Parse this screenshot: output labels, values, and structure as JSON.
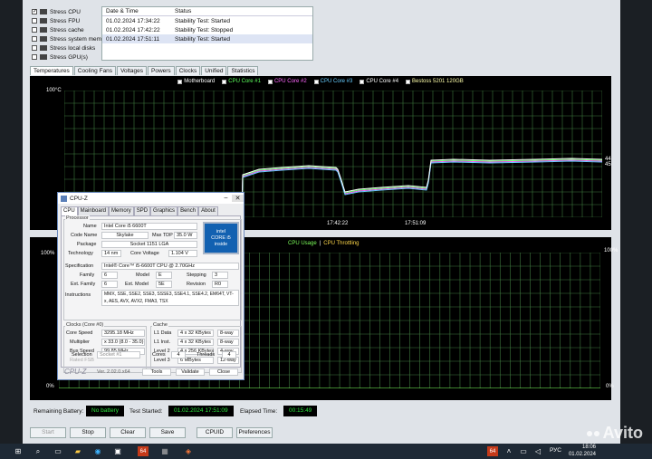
{
  "stress_options": [
    {
      "label": "Stress CPU",
      "checked": true,
      "icon": "cpu-icon"
    },
    {
      "label": "Stress FPU",
      "checked": false,
      "icon": "fpu-icon"
    },
    {
      "label": "Stress cache",
      "checked": false,
      "icon": "cache-icon"
    },
    {
      "label": "Stress system memory",
      "checked": false,
      "icon": "memory-icon"
    },
    {
      "label": "Stress local disks",
      "checked": false,
      "icon": "disk-icon"
    },
    {
      "label": "Stress GPU(s)",
      "checked": false,
      "icon": "gpu-icon"
    }
  ],
  "log": {
    "headers": [
      "Date & Time",
      "Status"
    ],
    "rows": [
      [
        "01.02.2024 17:34:22",
        "Stability Test: Started"
      ],
      [
        "01.02.2024 17:42:22",
        "Stability Test: Stopped"
      ],
      [
        "01.02.2024 17:51:11",
        "Stability Test: Started"
      ]
    ]
  },
  "tabs": [
    "Temperatures",
    "Cooling Fans",
    "Voltages",
    "Powers",
    "Clocks",
    "Unified",
    "Statistics"
  ],
  "temp_graph": {
    "legend": [
      "Motherboard",
      "CPU Core #1",
      "CPU Core #2",
      "CPU Core #3",
      "CPU Core #4",
      "Bestoss 5201 120GB"
    ],
    "legend_colors": [
      "#ffffff",
      "#5cff5c",
      "#ff66ff",
      "#66ccff",
      "#ffffff",
      "#ffffaa"
    ],
    "y_top": "100°C",
    "x_labels": [
      "17:42:22",
      "17:51:09"
    ],
    "end_values": [
      "44",
      "45"
    ]
  },
  "usage_graph": {
    "title_a": "CPU Usage",
    "title_sep": "|",
    "title_b": "CPU Throttling",
    "y_top": "100%",
    "y_bottom": "0%",
    "right_top": "100%",
    "right_bottom": "0%"
  },
  "footer": {
    "battery_label": "Remaining Battery:",
    "battery_value": "No battery",
    "started_label": "Test Started:",
    "started_value": "01.02.2024 17:51:09",
    "elapsed_label": "Elapsed Time:",
    "elapsed_value": "00:15:49"
  },
  "buttons": [
    "Start",
    "Stop",
    "Clear",
    "Save",
    "CPUID",
    "Preferences"
  ],
  "cpuz": {
    "title": "CPU-Z",
    "tabs": [
      "CPU",
      "Mainboard",
      "Memory",
      "SPD",
      "Graphics",
      "Bench",
      "About"
    ],
    "processor_group": "Processor",
    "name_label": "Name",
    "name": "Intel Core i5 6600T",
    "codename_label": "Code Name",
    "codename": "Skylake",
    "maxtdp_label": "Max TDP",
    "maxtdp": "35.0 W",
    "package_label": "Package",
    "package": "Socket 1151 LGA",
    "tech_label": "Technology",
    "tech": "14 nm",
    "cv_label": "Core Voltage",
    "cv": "1.104 V",
    "spec_label": "Specification",
    "spec": "Intel® Core™ i5-6600T CPU @ 2.70GHz",
    "family_label": "Family",
    "family": "6",
    "model_label": "Model",
    "model": "E",
    "stepping_label": "Stepping",
    "stepping": "3",
    "extfamily_label": "Ext. Family",
    "extfamily": "6",
    "extmodel_label": "Ext. Model",
    "extmodel": "5E",
    "revision_label": "Revision",
    "revision": "R0",
    "instr_label": "Instructions",
    "instr": "MMX, SSE, SSE2, SSE3, SSSE3, SSE4.1, SSE4.2, EM64T, VT-x, AES, AVX, AVX2, FMA3, TSX",
    "clocks_group": "Clocks (Core #0)",
    "corespeed_label": "Core Speed",
    "corespeed": "3295.18 MHz",
    "mult_label": "Multiplier",
    "mult": "x 33.0 (8.0 - 35.0)",
    "bus_label": "Bus Speed",
    "bus": "99.85 MHz",
    "fsb_label": "Rated FSB",
    "cache_group": "Cache",
    "l1d_label": "L1 Data",
    "l1d": "4 x 32 KBytes",
    "l1d_way": "8-way",
    "l1i_label": "L1 Inst.",
    "l1i": "4 x 32 KBytes",
    "l1i_way": "8-way",
    "l2_label": "Level 2",
    "l2": "4 x 256 KBytes",
    "l2_way": "4-way",
    "l3_label": "Level 3",
    "l3": "6 MBytes",
    "l3_way": "12-way",
    "selection_label": "Selection",
    "selection": "Socket #1",
    "cores_label": "Cores",
    "cores": "4",
    "threads_label": "Threads",
    "threads": "4",
    "brand": "CPU-Z",
    "version": "Ver. 2.02.0.x64",
    "tools": "Tools",
    "validate": "Validate",
    "close": "Close",
    "logo_line1": "intel",
    "logo_line2": "CORE i5",
    "logo_line3": "inside"
  },
  "taskbar": {
    "lang": "РУС",
    "time": "18:06",
    "date": "01.02.2024",
    "app_badge": "64"
  },
  "watermark": "Avito"
}
